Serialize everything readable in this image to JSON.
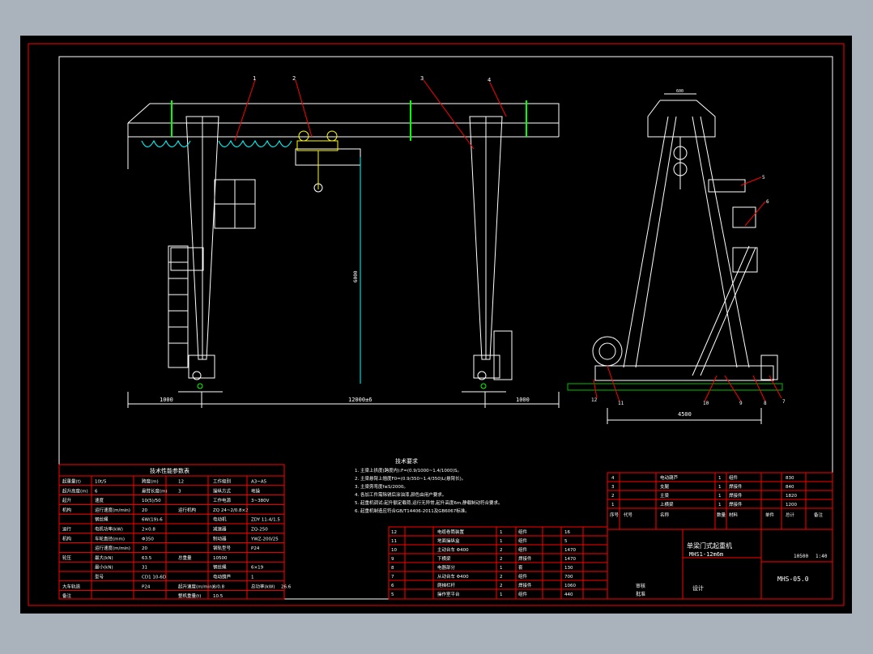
{
  "colors": {
    "background": "#000000",
    "outer_border": "#ff0000",
    "drawing_line": "#ffffff",
    "dimension": "#00ffff",
    "rail": "#00c000",
    "hoist": "#ffff00",
    "table_text": "#ffffff"
  },
  "labels": {
    "leader_1": "1",
    "leader_2": "2",
    "leader_3": "3",
    "leader_4": "4",
    "leader_5": "5",
    "leader_6": "6",
    "leader_7": "7",
    "leader_8": "8",
    "leader_9": "9",
    "leader_10": "10",
    "leader_11": "11",
    "leader_12": "12"
  },
  "dimensions": {
    "left_overhang": "1000",
    "span": "12000±6",
    "right_overhang": "1000",
    "lift_height": "6000",
    "side_track": "4500",
    "side_top": "600"
  },
  "notes": {
    "title": "技术要求",
    "lines": [
      "1. 主梁上拱度(跨度内):F=(0.9/1000~1.4/1000)S。",
      "2. 主梁悬臂上翘度F0=(0.9/350~1.4/350)L(悬臂长)。",
      "3. 主梁旁弯度f≤S/2000。",
      "4. 各加工件需除锈后涂油漆,颜色由用户要求。",
      "5. 起重机调试:起升额定载荷,运行无异常,起升高度6m,静载制动符合要求。",
      "6. 起重机制造应符合GB/T14406-2011及GB6067标准。"
    ]
  },
  "params_table": {
    "title": "技术性能参数表",
    "rows": [
      [
        "起重量(t)",
        "10t/5",
        "跨度(m)",
        "12",
        "工作级别",
        "A3~A5"
      ],
      [
        "起升高度(m)",
        "6",
        "悬臂长度(m)",
        "3",
        "操纵方式",
        "地操"
      ],
      [
        "起升",
        "速度",
        "10(5)/50",
        "",
        "工作电源",
        "3~380V"
      ],
      [
        "机构",
        "运行速度(m/min)",
        "20",
        "运行机构",
        "ZQ 24~2/0.8×2"
      ],
      [
        "",
        "钢丝绳",
        "6W(19)-6",
        "",
        "电动机",
        "ZDY 11-4/1.5"
      ],
      [
        "运行",
        "电机功率(kW)",
        "2×0.8",
        "",
        "减速器",
        "ZQ-250"
      ],
      [
        "机构",
        "车轮直径(mm)",
        "Φ350",
        "",
        "制动器",
        "YWZ-200/25"
      ],
      [
        "",
        "运行速度(m/min)",
        "20",
        "",
        "钢轨型号",
        "P24"
      ],
      [
        "轮压",
        "最大(kN)",
        "63.5",
        "总重量",
        "10500"
      ],
      [
        "",
        "最小(kN)",
        "31",
        "",
        "钢丝绳",
        "6×19"
      ],
      [
        "",
        "型号",
        "CD1 10-6D",
        "",
        "电动葫芦",
        "1"
      ],
      [
        "大车轨道",
        "",
        "P24",
        "起升速度(m/min)",
        "8/0.8",
        "总功率(kW)",
        "26.6"
      ],
      [
        "备注",
        "",
        "",
        "整机重量(t)",
        "10.5"
      ]
    ]
  },
  "bom": {
    "headers": [
      "序号",
      "代号",
      "名称",
      "数量",
      "材料",
      "单件",
      "总计",
      "备注"
    ],
    "rows": [
      [
        "12",
        "",
        "电缆卷筒装置",
        "1",
        "组件",
        "",
        "16",
        ""
      ],
      [
        "11",
        "",
        "地面操纵盒",
        "1",
        "组件",
        "",
        "5",
        ""
      ],
      [
        "10",
        "",
        "主动台车 Φ400",
        "2",
        "组件",
        "",
        "1470",
        ""
      ],
      [
        "9",
        "",
        "下横梁",
        "2",
        "焊接件",
        "",
        "1470",
        ""
      ],
      [
        "8",
        "",
        "电器部分",
        "1",
        "套",
        "",
        "130",
        ""
      ],
      [
        "7",
        "",
        "从动台车 Φ400",
        "2",
        "组件",
        "",
        "700",
        ""
      ],
      [
        "6",
        "",
        "爬梯栏杆",
        "2",
        "焊接件",
        "",
        "1060",
        ""
      ],
      [
        "5",
        "",
        "操作室平台",
        "1",
        "组件",
        "",
        "440",
        ""
      ]
    ],
    "upper_rows": [
      [
        "4",
        "",
        "电动葫芦",
        "1",
        "组件",
        "",
        "830",
        ""
      ],
      [
        "3",
        "",
        "支腿",
        "1",
        "焊接件",
        "",
        "840",
        ""
      ],
      [
        "2",
        "",
        "主梁",
        "1",
        "焊接件",
        "",
        "1820",
        ""
      ],
      [
        "1",
        "",
        "上横梁",
        "1",
        "焊接件",
        "",
        "1200",
        ""
      ]
    ]
  },
  "title_block": {
    "name": "单梁门式起重机",
    "model": "MHS1-12m6m",
    "drawing_no": "MHS-05.0",
    "scale": "1:40",
    "weight": "10500",
    "designer": "设计",
    "checker": "审核",
    "approver": "批准"
  }
}
